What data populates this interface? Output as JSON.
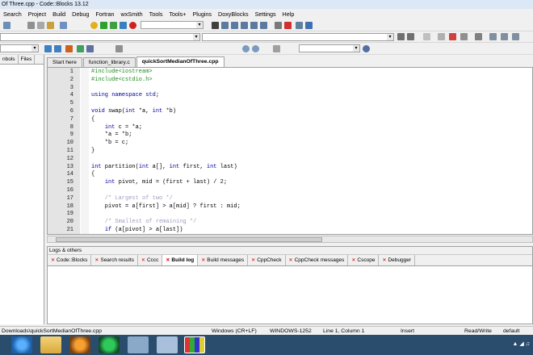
{
  "window": {
    "title": "Of Three.cpp - Code::Blocks 13.12"
  },
  "menu": [
    "Search",
    "Project",
    "Build",
    "Debug",
    "Fortran",
    "wxSmith",
    "Tools",
    "Tools+",
    "Plugins",
    "DoxyBlocks",
    "Settings",
    "Help"
  ],
  "left_panel": {
    "tabs": [
      "nbols",
      "Files"
    ]
  },
  "editor_tabs": [
    {
      "label": "Start here"
    },
    {
      "label": "function_library.c"
    },
    {
      "label": "quickSortMedianOfThree.cpp",
      "active": true
    }
  ],
  "code_lines": [
    {
      "n": "1",
      "text": "#include<iostream>"
    },
    {
      "n": "2",
      "text": "#include<cstdio.h>"
    },
    {
      "n": "3",
      "text": ""
    },
    {
      "n": "4",
      "text": "using namespace std;"
    },
    {
      "n": "5",
      "text": ""
    },
    {
      "n": "6",
      "text": "void swap(int *a, int *b)"
    },
    {
      "n": "7",
      "text": "{"
    },
    {
      "n": "8",
      "text": "    int c = *a;"
    },
    {
      "n": "9",
      "text": "    *a = *b;"
    },
    {
      "n": "10",
      "text": "    *b = c;"
    },
    {
      "n": "11",
      "text": "}"
    },
    {
      "n": "12",
      "text": ""
    },
    {
      "n": "13",
      "text": "int partition(int a[], int first, int last)"
    },
    {
      "n": "14",
      "text": "{"
    },
    {
      "n": "15",
      "text": "    int pivot, mid = (first + last) / 2;"
    },
    {
      "n": "16",
      "text": ""
    },
    {
      "n": "17",
      "text": "    /* Largest of two */"
    },
    {
      "n": "18",
      "text": "    pivot = a[first] > a[mid] ? first : mid;"
    },
    {
      "n": "19",
      "text": ""
    },
    {
      "n": "20",
      "text": "    /* Smallest of remaining */"
    },
    {
      "n": "21",
      "text": "    if (a[pivot] > a[last])"
    }
  ],
  "logs": {
    "title": "Logs & others",
    "tabs": [
      "Code::Blocks",
      "Search results",
      "Cccc",
      "Build log",
      "Build messages",
      "CppCheck",
      "CppCheck messages",
      "Cscope",
      "Debugger"
    ]
  },
  "status": {
    "path": "Downloads\\quickSortMedianOfThree.cpp",
    "eol": "Windows (CR+LF)",
    "encoding": "WINDOWS-1252",
    "position": "Line 1, Column 1",
    "mode": "Insert",
    "access": "Read/Write",
    "lang": "default"
  },
  "colors": {
    "accent": "#2a4d6e",
    "preprocessor": "#1e8f1e",
    "keyword": "#0000a0",
    "comment": "#a0a0c0"
  }
}
